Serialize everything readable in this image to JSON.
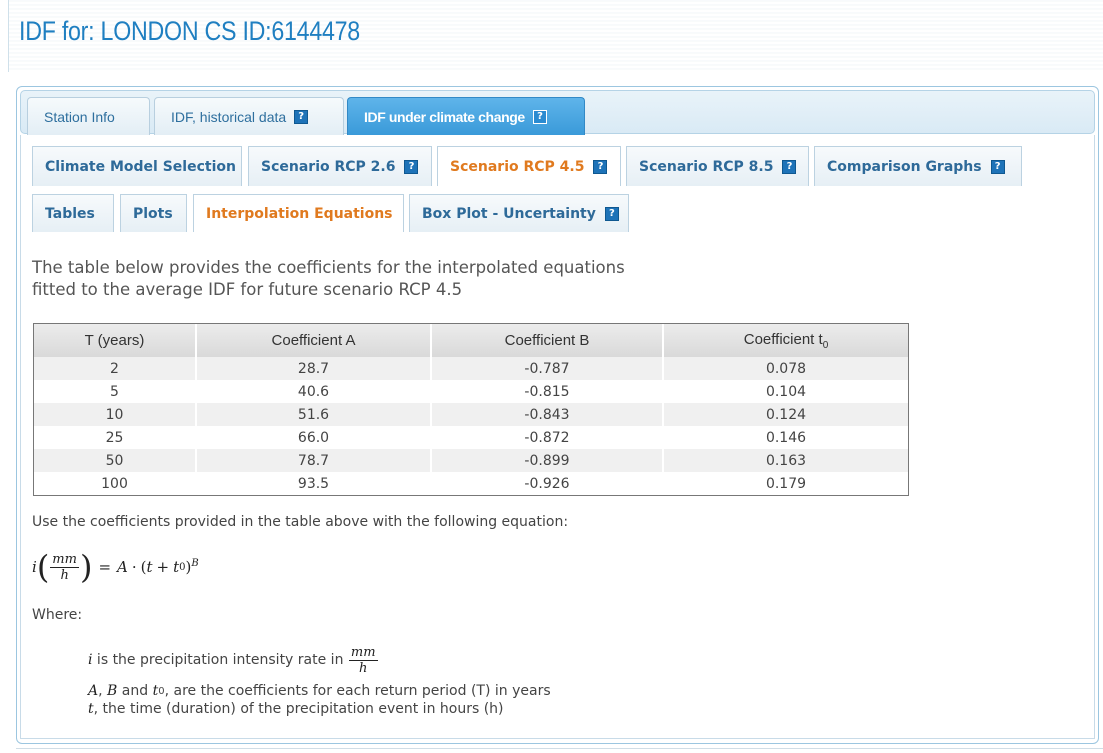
{
  "page_title": "IDF for: LONDON CS ID:6144478",
  "main_tabs": [
    {
      "label": "Station Info",
      "help": false
    },
    {
      "label": "IDF, historical data",
      "help": true
    },
    {
      "label": "IDF under climate change",
      "help": true
    }
  ],
  "scenario_tabs": [
    {
      "label": "Climate Model Selection",
      "help": false
    },
    {
      "label": "Scenario RCP 2.6",
      "help": true
    },
    {
      "label": "Scenario RCP 4.5",
      "help": true
    },
    {
      "label": "Scenario RCP 8.5",
      "help": true
    },
    {
      "label": "Comparison Graphs",
      "help": true
    }
  ],
  "view_tabs": [
    {
      "label": "Tables",
      "help": false
    },
    {
      "label": "Plots",
      "help": false
    },
    {
      "label": "Interpolation Equations",
      "help": false
    },
    {
      "label": "Box Plot - Uncertainty",
      "help": true
    }
  ],
  "help_icon": "?",
  "intro_line1": "The table below provides the coefficients for the interpolated equations",
  "intro_line2": "fitted to the average IDF for future scenario RCP 4.5",
  "table": {
    "headers": [
      "T (years)",
      "Coefficient A",
      "Coefficient B",
      "Coefficient t"
    ],
    "t_sub": "0",
    "rows": [
      [
        "2",
        "28.7",
        "-0.787",
        "0.078"
      ],
      [
        "5",
        "40.6",
        "-0.815",
        "0.104"
      ],
      [
        "10",
        "51.6",
        "-0.843",
        "0.124"
      ],
      [
        "25",
        "66.0",
        "-0.872",
        "0.146"
      ],
      [
        "50",
        "78.7",
        "-0.899",
        "0.163"
      ],
      [
        "100",
        "93.5",
        "-0.926",
        "0.179"
      ]
    ]
  },
  "use_text": "Use the coefficients provided in the table above with the following equation:",
  "equation": {
    "lhs": "i",
    "unit_num": "mm",
    "unit_den": "h",
    "equals": "=",
    "rhs_a": "A",
    "dot": "·",
    "open": "(",
    "t": "t",
    "plus": "+",
    "t0": "t",
    "t0_sub": "0",
    "close": ")",
    "exp": "B"
  },
  "where_label": "Where:",
  "definitions": {
    "d1_var": "i",
    "d1_text": " is the precipitation intensity rate in ",
    "d1_unit_num": "mm",
    "d1_unit_den": "h",
    "d2_a": "A",
    "d2_comma": ", ",
    "d2_b": "B",
    "d2_and": " and ",
    "d2_t": "t",
    "d2_t_sub": "0",
    "d2_text": ", are the coefficients for each return period (T) in years",
    "d3_var": "t",
    "d3_text": ", the time (duration) of the precipitation event in hours (h)"
  }
}
